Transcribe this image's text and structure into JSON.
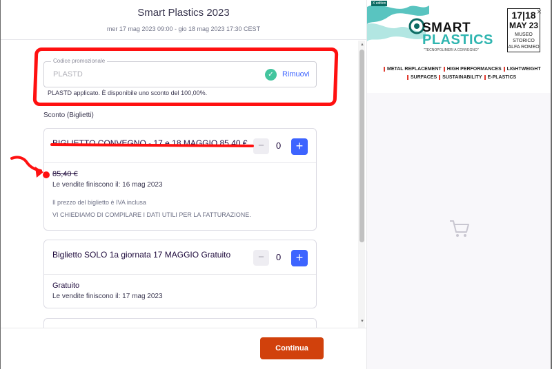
{
  "header": {
    "title": "Smart Plastics 2023",
    "dates": "mer 17 mag 2023 09:00 - gio 18 mag 2023 17:30 CEST"
  },
  "promo": {
    "legend": "Codice promozionale",
    "value": "PLASTD",
    "remove_label": "Rimuovi",
    "note": "PLASTD applicato. È disponibile uno sconto del 100,00%."
  },
  "section_label": "Sconto (Biglietti)",
  "tickets": [
    {
      "name": "BIGLIETTO CONVEGNO - 17 e 18 MAGGIO 85,40 €",
      "quantity": "0",
      "minus_label": "−",
      "plus_label": "+",
      "price": "85,40 €",
      "sale_end": "Le vendite finiscono il: 16 mag 2023",
      "vat_note": "Il prezzo del biglietto è IVA inclusa",
      "data_note": "VI CHIEDIAMO DI COMPILARE I DATI UTILI PER LA FATTURAZIONE."
    },
    {
      "name": "Biglietto SOLO 1a giornata 17 MAGGIO Gratuito",
      "quantity": "0",
      "minus_label": "−",
      "plus_label": "+",
      "price": "Gratuito",
      "sale_end": "Le vendite finiscono il: 17 mag 2023"
    }
  ],
  "footer": {
    "continue_label": "Continua"
  },
  "banner": {
    "edition": "X edition",
    "logo_line1": "SMART",
    "logo_line2": "PLASTICS",
    "tagline": "\"TECNOPOLIMERI A CONVEGNO\"",
    "date_days": "17|18",
    "date_month": "MAY 23",
    "venue_line1": "MUSEO STORICO",
    "venue_line2": "ALFA ROMEO",
    "tags_line1": [
      "METAL REPLACEMENT",
      "HIGH PERFORMANCES",
      "LIGHTWEIGHT"
    ],
    "tags_line2": [
      "SURFACES",
      "SUSTAINABILITY",
      "E-PLASTICS"
    ],
    "close_label": "×"
  },
  "colors": {
    "accent_blue": "#3d64ff",
    "continue_orange": "#d1410c",
    "check_green": "#43c59e",
    "annotation_red": "#ff1010",
    "brand_teal": "#2fb5b0"
  },
  "icons": {
    "check": "check-icon",
    "close": "close-icon",
    "cart": "cart-icon"
  }
}
